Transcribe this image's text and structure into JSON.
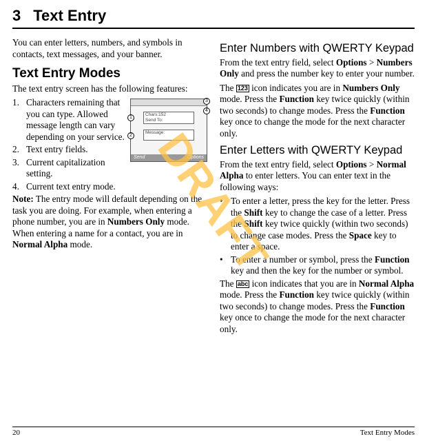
{
  "watermark": "DRAFT",
  "chapter": {
    "number": "3",
    "title": "Text Entry"
  },
  "left": {
    "intro": "You can enter letters, numbers, and symbols in contacts, text messages, and your banner.",
    "h2": "Text Entry Modes",
    "lead": "The text entry screen has the following features:",
    "items": [
      "Characters remaining that you can type. Allowed message length can vary depending on your service.",
      "Text entry fields.",
      "Current capitalization setting.",
      "Current text entry mode."
    ],
    "note_label": "Note:",
    "note_a": " The entry mode will default depending on the task you are doing. For example, when entering a phone number, you are in ",
    "note_b": "Numbers Only",
    "note_c": " mode. When entering a name for a contact, you are in ",
    "note_d": "Normal Alpha",
    "note_e": " mode.",
    "fig": {
      "chars": "Chars:152",
      "sendto": "Send To:",
      "message": "Message:",
      "soft_left": "Send",
      "soft_right": "Options",
      "call_1": "1",
      "call_2": "2",
      "call_3": "3",
      "call_4": "4"
    }
  },
  "right": {
    "s1_title": "Enter Numbers with QWERTY Keypad",
    "s1_a": "From the text entry field, select ",
    "s1_b": "Options",
    "s1_c": " > ",
    "s1_d": "Numbers Only",
    "s1_e": " and press the number key to enter your number.",
    "s1_icon": "123",
    "s1_p2a": "The ",
    "s1_p2b": " icon indicates you are in ",
    "s1_p2c": "Numbers Only",
    "s1_p2d": " mode. Press the ",
    "s1_p2e": "Function",
    "s1_p2f": " key twice quickly (within two seconds) to change modes. Press the ",
    "s1_p2g": "Function",
    "s1_p2h": " key once to change the mode for the next character only.",
    "s2_title": "Enter Letters with QWERTY Keypad",
    "s2_a": "From the text entry field, select ",
    "s2_b": "Options",
    "s2_c": " > ",
    "s2_d": "Normal Alpha",
    "s2_e": " to enter letters. You can enter text in the following ways:",
    "b1a": "To enter a letter, press the key for the letter. Press the ",
    "b1b": "Shift",
    "b1c": " key to change the case of a letter. Press the ",
    "b1d": "Shift",
    "b1e": " key twice quickly (within two seconds) to change case modes. Press the ",
    "b1f": "Space",
    "b1g": " key to enter a space.",
    "b2a": "To enter a number or symbol, press the ",
    "b2b": "Function",
    "b2c": " key and then the key for the number or symbol.",
    "s2_icon": "abc",
    "s2_p2a": "The ",
    "s2_p2b": " icon indicates that you are in ",
    "s2_p2c": "Normal Alpha",
    "s2_p2d": " mode. Press the ",
    "s2_p2e": "Function",
    "s2_p2f": " key twice quickly (within two seconds) to change modes. Press the ",
    "s2_p2g": "Function",
    "s2_p2h": " key once to change the mode for the next character only."
  },
  "footer": {
    "page": "20",
    "section": "Text Entry Modes"
  }
}
